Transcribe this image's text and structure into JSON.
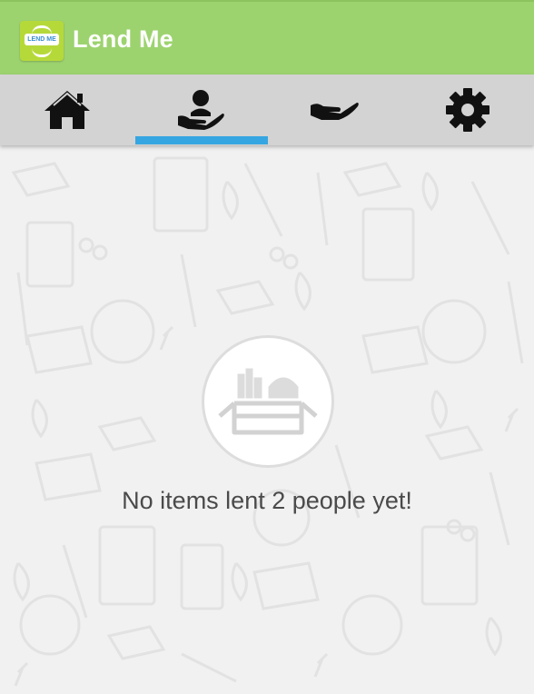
{
  "app": {
    "title": "Lend Me",
    "logo_text": "LEND ME"
  },
  "tabs": [
    {
      "id": "home",
      "icon": "home-icon",
      "selected": false
    },
    {
      "id": "lent",
      "icon": "person-on-hand-icon",
      "selected": true
    },
    {
      "id": "borrowed",
      "icon": "open-hand-icon",
      "selected": false
    },
    {
      "id": "settings",
      "icon": "gear-icon",
      "selected": false
    }
  ],
  "empty_state": {
    "icon": "box-of-items-icon",
    "message": "No items lent 2 people yet!"
  },
  "colors": {
    "app_bar": "#9dd36f",
    "tab_bar": "#d3d3d3",
    "tab_indicator": "#36a6e2",
    "background": "#f1f1f1"
  }
}
